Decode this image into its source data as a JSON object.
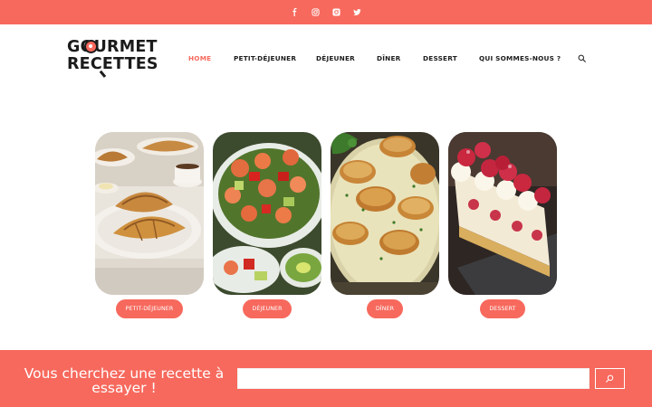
{
  "social": {
    "items": [
      {
        "icon": "facebook-icon"
      },
      {
        "icon": "instagram-icon"
      },
      {
        "icon": "instagram-square-icon"
      },
      {
        "icon": "twitter-icon"
      }
    ]
  },
  "logo": {
    "line1": "GOURMET",
    "line2": "RECETTES"
  },
  "nav": {
    "items": [
      {
        "label": "HOME"
      },
      {
        "label": "PETIT-DÉJEUNER"
      },
      {
        "label": "DÉJEUNER"
      },
      {
        "label": "DÎNER"
      },
      {
        "label": "DESSERT"
      },
      {
        "label": "QUI SOMMES-NOUS ?"
      }
    ],
    "active_index": 0,
    "search_icon": "search-icon"
  },
  "categories": [
    {
      "label": "PETIT-DÉJEUNER",
      "image": "croissants-photo"
    },
    {
      "label": "DÉJEUNER",
      "image": "shrimp-salad-photo"
    },
    {
      "label": "DÎNER",
      "image": "scallops-photo"
    },
    {
      "label": "DESSERT",
      "image": "raspberry-cake-photo"
    }
  ],
  "search_band": {
    "title": "Vous cherchez une recette à essayer !",
    "input_value": "",
    "button_icon": "search-icon"
  },
  "colors": {
    "accent": "#f7695d",
    "text": "#1d1d1d",
    "white": "#ffffff"
  }
}
